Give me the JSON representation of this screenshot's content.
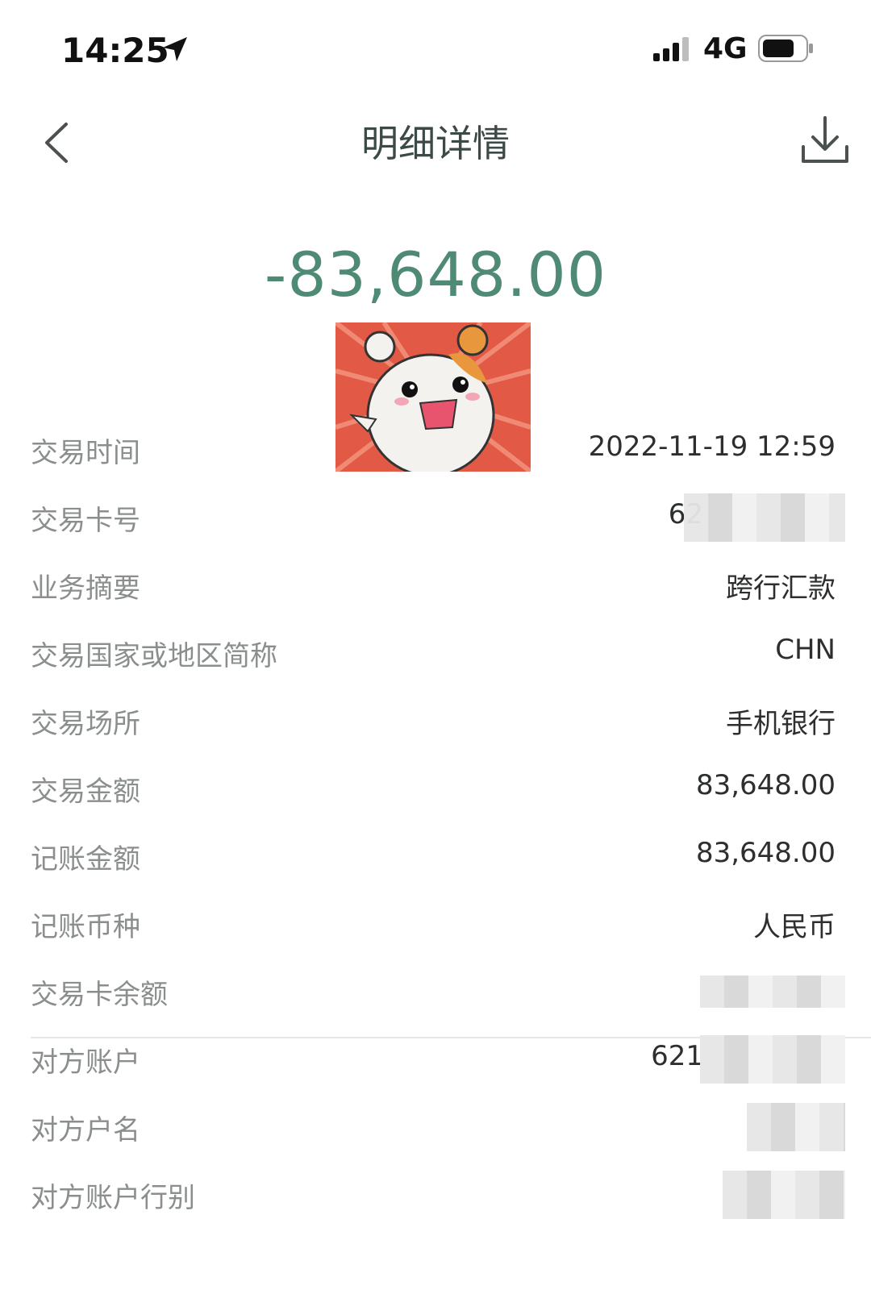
{
  "status_bar": {
    "time": "14:25",
    "network": "4G",
    "icons": [
      "location-arrow-icon",
      "signal-icon",
      "battery-icon"
    ]
  },
  "nav": {
    "title": "明细详情",
    "icons": [
      "back-chevron-icon",
      "download-icon"
    ]
  },
  "transaction": {
    "amount": "-83,648.00"
  },
  "colors": {
    "amount": "#4f8a74",
    "title": "#3c4a47",
    "label": "#8a8f8e",
    "value": "#2c2f2e"
  },
  "details": [
    {
      "label": "交易时间",
      "value": "2022-11-19 12:59"
    },
    {
      "label": "交易卡号",
      "value": "62"
    },
    {
      "label": "业务摘要",
      "value": "跨行汇款"
    },
    {
      "label": "交易国家或地区简称",
      "value": "CHN"
    },
    {
      "label": "交易场所",
      "value": "手机银行"
    },
    {
      "label": "交易金额",
      "value": "83,648.00"
    },
    {
      "label": "记账金额",
      "value": "83,648.00"
    },
    {
      "label": "记账币种",
      "value": "人民币"
    },
    {
      "label": "交易卡余额",
      "value": ""
    },
    {
      "label": "对方账户",
      "value": "621"
    },
    {
      "label": "对方户名",
      "value": ""
    },
    {
      "label": "对方账户行别",
      "value": ""
    }
  ]
}
